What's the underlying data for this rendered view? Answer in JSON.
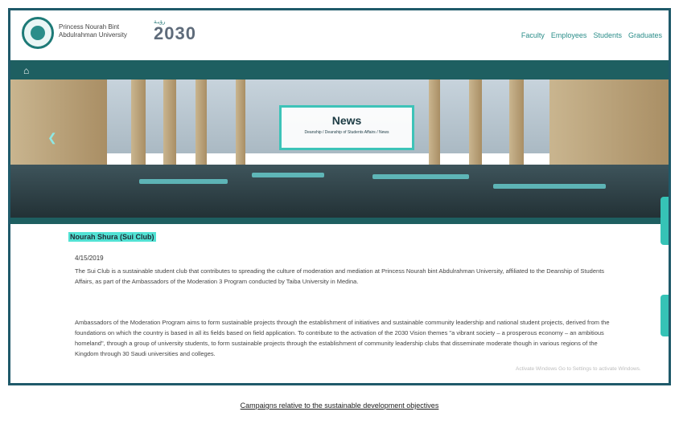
{
  "header": {
    "university_name": "Princess Nourah Bint Abdulrahman University",
    "vision_arabic": "رؤيـة",
    "vision_year": "2030",
    "nav": [
      "Faculty",
      "Employees",
      "Students",
      "Graduates"
    ]
  },
  "hero": {
    "title": "News",
    "breadcrumb": "Deanship / Deanship of Students Affairs / News"
  },
  "article": {
    "title": "Nourah Shura (Sui Club)",
    "date": "4/15/2019",
    "paragraph1": "The Sui Club is a sustainable student club that contributes to spreading the culture of moderation and mediation at Princess Nourah bint Abdulrahman University, affiliated to the Deanship of Students Affairs, as part of the Ambassadors of the Moderation 3 Program conducted by Taiba University in Medina.",
    "paragraph2": "Ambassadors of the Moderation Program aims to form sustainable projects through the establishment of initiatives and sustainable community leadership and national student projects, derived from the foundations on which the country is based in all its fields based on field application. To contribute to the activation of the 2030 Vision themes \"a vibrant society – a prosperous economy – an ambitious homeland\", through a group of university students, to form sustainable projects through the establishment of community leadership clubs that disseminate moderate though in various regions of the Kingdom through 30 Saudi universities and colleges."
  },
  "watermark": "Activate Windows\nGo to Settings to activate Windows.",
  "caption": "Campaigns relative to the sustainable development objectives",
  "colors": {
    "teal_dark": "#1e5f61",
    "teal_accent": "#36c3b6",
    "highlight": "#52e2d4"
  }
}
